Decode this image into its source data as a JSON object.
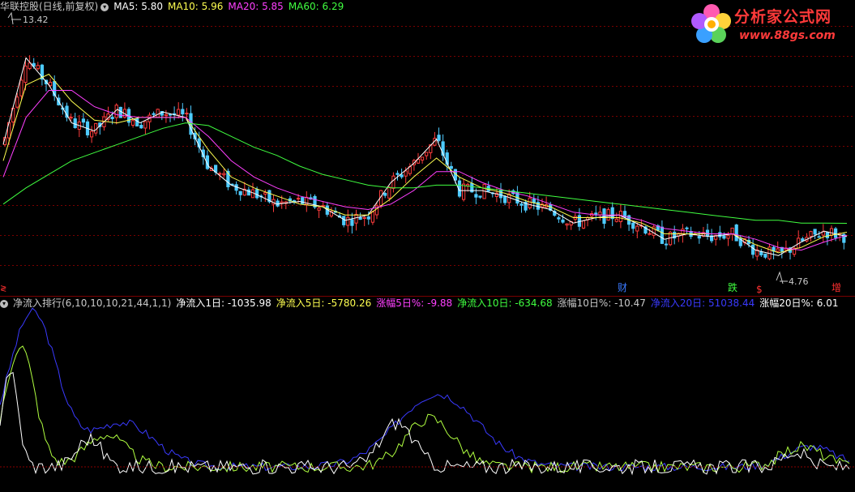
{
  "main_legend": {
    "title": "华联控股(日线,前复权)",
    "icon": "circle-chevron-icon",
    "ma5": "MA5: 5.80",
    "ma10": "MA10: 5.96",
    "ma20": "MA20: 5.85",
    "ma60": "MA60: 6.29"
  },
  "price_labels": {
    "high": "13.42",
    "low": "4.76"
  },
  "markers": {
    "cai": "财",
    "die": "跌",
    "dollar": "$",
    "zeng": "增",
    "edge": "≷"
  },
  "indicator_legend": {
    "icon": "circle-chevron-icon",
    "name": "净流入排行(6,10,10,10,21,44,1,1)",
    "inflow1": "净流入1日: -1035.98",
    "inflow5": "净流入5日: -5780.26",
    "change5": "涨幅5日%: -9.88",
    "inflow10": "净流入10日: -634.68",
    "change10": "涨幅10日%: -10.47",
    "inflow20": "净流入20日: 51038.44",
    "change20": "涨幅20日%: 6.01"
  },
  "watermark": {
    "line1": "分析家公式网",
    "line2": "www.88gs.com"
  },
  "colors": {
    "background": "#000000",
    "grid": "#7a0000",
    "up": "#ff3c3c",
    "down": "#4ecbff",
    "ma5": "#ffffff",
    "ma10": "#ffff50",
    "ma20": "#ff40ff",
    "ma60": "#40ff40",
    "legend_text": "#c8c8c8",
    "ind_blue": "#3a3aff",
    "ind_green": "#b0ff40",
    "ind_white": "#ffffff"
  },
  "chart_data": {
    "type": "candlestick",
    "y_axis": "price",
    "ylim": [
      4.0,
      14.0
    ],
    "high_price": 13.42,
    "low_price": 4.76,
    "series": [
      {
        "name": "MA5",
        "values": [
          9.2,
          12.4,
          11.4,
          10.0,
          9.7,
          10.5,
          10.0,
          10.4,
          10.2,
          8.4,
          7.7,
          7.4,
          7.0,
          7.1,
          6.9,
          6.4,
          6.6,
          7.8,
          8.5,
          9.4,
          7.5,
          7.5,
          7.3,
          7.0,
          6.8,
          6.3,
          6.5,
          6.6,
          6.2,
          5.7,
          5.9,
          5.8,
          5.9,
          5.3,
          5.1,
          5.6,
          6.0,
          5.8
        ]
      },
      {
        "name": "MA10",
        "values": [
          8.6,
          11.4,
          11.8,
          10.8,
          10.1,
          10.0,
          10.2,
          10.2,
          10.2,
          9.0,
          8.0,
          7.6,
          7.3,
          7.0,
          6.9,
          6.6,
          6.6,
          7.2,
          8.0,
          8.7,
          8.0,
          7.6,
          7.4,
          7.1,
          6.9,
          6.5,
          6.5,
          6.5,
          6.3,
          5.9,
          5.9,
          5.9,
          5.9,
          5.5,
          5.2,
          5.4,
          5.8,
          5.96
        ]
      },
      {
        "name": "MA20",
        "values": [
          8.0,
          10.2,
          11.2,
          11.2,
          10.6,
          10.3,
          10.2,
          10.2,
          10.2,
          9.5,
          8.6,
          8.0,
          7.6,
          7.3,
          7.1,
          6.9,
          6.8,
          7.0,
          7.5,
          8.2,
          8.2,
          7.8,
          7.5,
          7.3,
          7.0,
          6.7,
          6.6,
          6.6,
          6.4,
          6.1,
          6.0,
          5.9,
          5.9,
          5.7,
          5.4,
          5.3,
          5.6,
          5.85
        ]
      },
      {
        "name": "MA60",
        "values": [
          7.0,
          7.6,
          8.1,
          8.6,
          8.9,
          9.2,
          9.5,
          9.8,
          10.0,
          9.9,
          9.5,
          9.1,
          8.8,
          8.4,
          8.1,
          7.9,
          7.7,
          7.6,
          7.6,
          7.7,
          7.7,
          7.6,
          7.5,
          7.4,
          7.3,
          7.2,
          7.1,
          7.0,
          6.9,
          6.8,
          6.7,
          6.6,
          6.5,
          6.4,
          6.4,
          6.3,
          6.3,
          6.29
        ]
      }
    ]
  }
}
